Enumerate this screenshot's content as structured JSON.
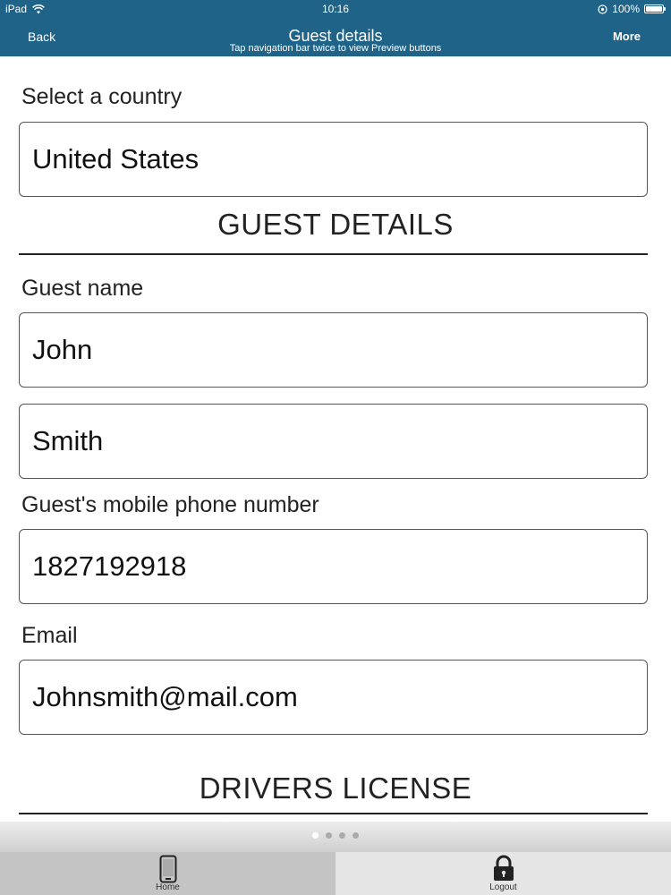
{
  "status_bar": {
    "device": "iPad",
    "time": "10:16",
    "battery": "100%"
  },
  "nav": {
    "back_label": "Back",
    "title": "Guest details",
    "subtitle": "Tap navigation bar twice to view Preview buttons",
    "more_label": "More"
  },
  "form": {
    "country_label": "Select a country",
    "country_value": "United States",
    "guest_section_title": "GUEST DETAILS",
    "guest_name_label": "Guest name",
    "first_name_value": "John",
    "last_name_value": "Smith",
    "phone_label": "Guest's mobile phone number",
    "phone_value": "1827192918",
    "email_label": "Email",
    "email_value": "Johnsmith@mail.com",
    "license_section_title": "DRIVERS LICENSE"
  },
  "pager": {
    "count": 4,
    "active": 0
  },
  "tabs": [
    {
      "label": "Home",
      "icon": "phone-icon"
    },
    {
      "label": "Logout",
      "icon": "lock-icon"
    }
  ],
  "colors": {
    "nav_background": "#1f6488"
  }
}
